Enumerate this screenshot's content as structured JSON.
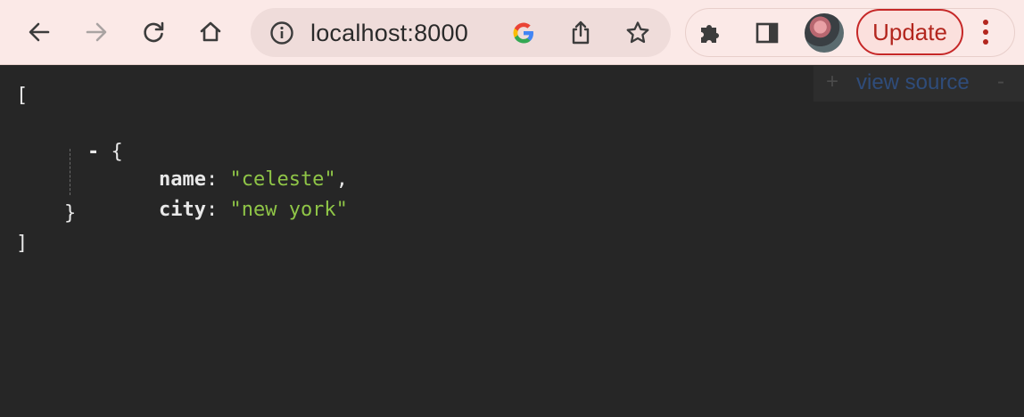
{
  "browser": {
    "omnibox": {
      "url": "localhost:8000"
    },
    "update_label": "Update",
    "icons": {
      "back": "arrow-left",
      "forward": "arrow-right",
      "reload": "reload",
      "home": "home",
      "site_info": "info",
      "google": "google-g",
      "share": "share",
      "bookmark": "star",
      "extensions": "puzzle",
      "side_panel": "side-panel",
      "profile": "avatar",
      "menu": "three-dots-vertical"
    },
    "colors": {
      "toolbar_bg": "#fbe9e7",
      "update_accent": "#c62828",
      "content_bg": "#262626",
      "string_color": "#8fc547"
    }
  },
  "json_viewer": {
    "open_bracket": "[",
    "collapse_toggle": "-",
    "open_brace": "{",
    "entries": [
      {
        "key": "name",
        "value": "\"celeste\"",
        "trailing": ","
      },
      {
        "key": "city",
        "value": "\"new york\"",
        "trailing": ""
      }
    ],
    "close_brace": "}",
    "close_bracket": "]",
    "view_source": {
      "plus": "+",
      "label": "view source",
      "minus": "-"
    }
  }
}
